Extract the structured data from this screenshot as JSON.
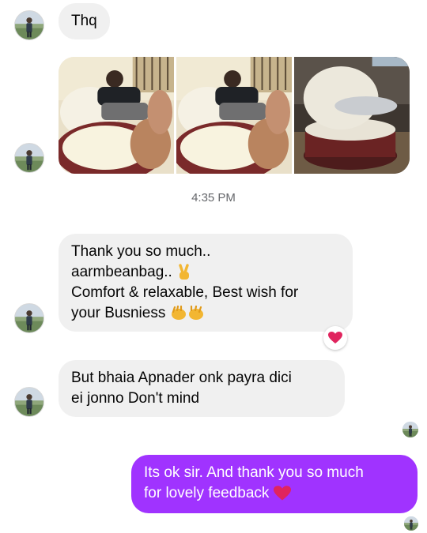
{
  "messages": {
    "m1": {
      "text": "Thq"
    },
    "m2": {
      "lines": [
        "Thank you so much..",
        "aarmbeanbag..",
        "Comfort & relaxable, Best wish for",
        "your Busniess"
      ]
    },
    "m3": {
      "lines": [
        "But bhaia Apnader  onk payra dici",
        "ei jonno Don't mind"
      ]
    },
    "m4": {
      "lines": [
        "Its ok sir. And thank you so much",
        "for lovely feedback"
      ]
    }
  },
  "timestamp": "4:35 PM",
  "icons": {
    "victory": "victory-hand-icon",
    "hands": "open-hands-icon",
    "heart": "red-heart-icon"
  },
  "colors": {
    "outgoing_bubble": "#a033ff",
    "incoming_bubble": "#f0f0f0",
    "heart": "#e0245e",
    "timestamp": "#65676b"
  }
}
